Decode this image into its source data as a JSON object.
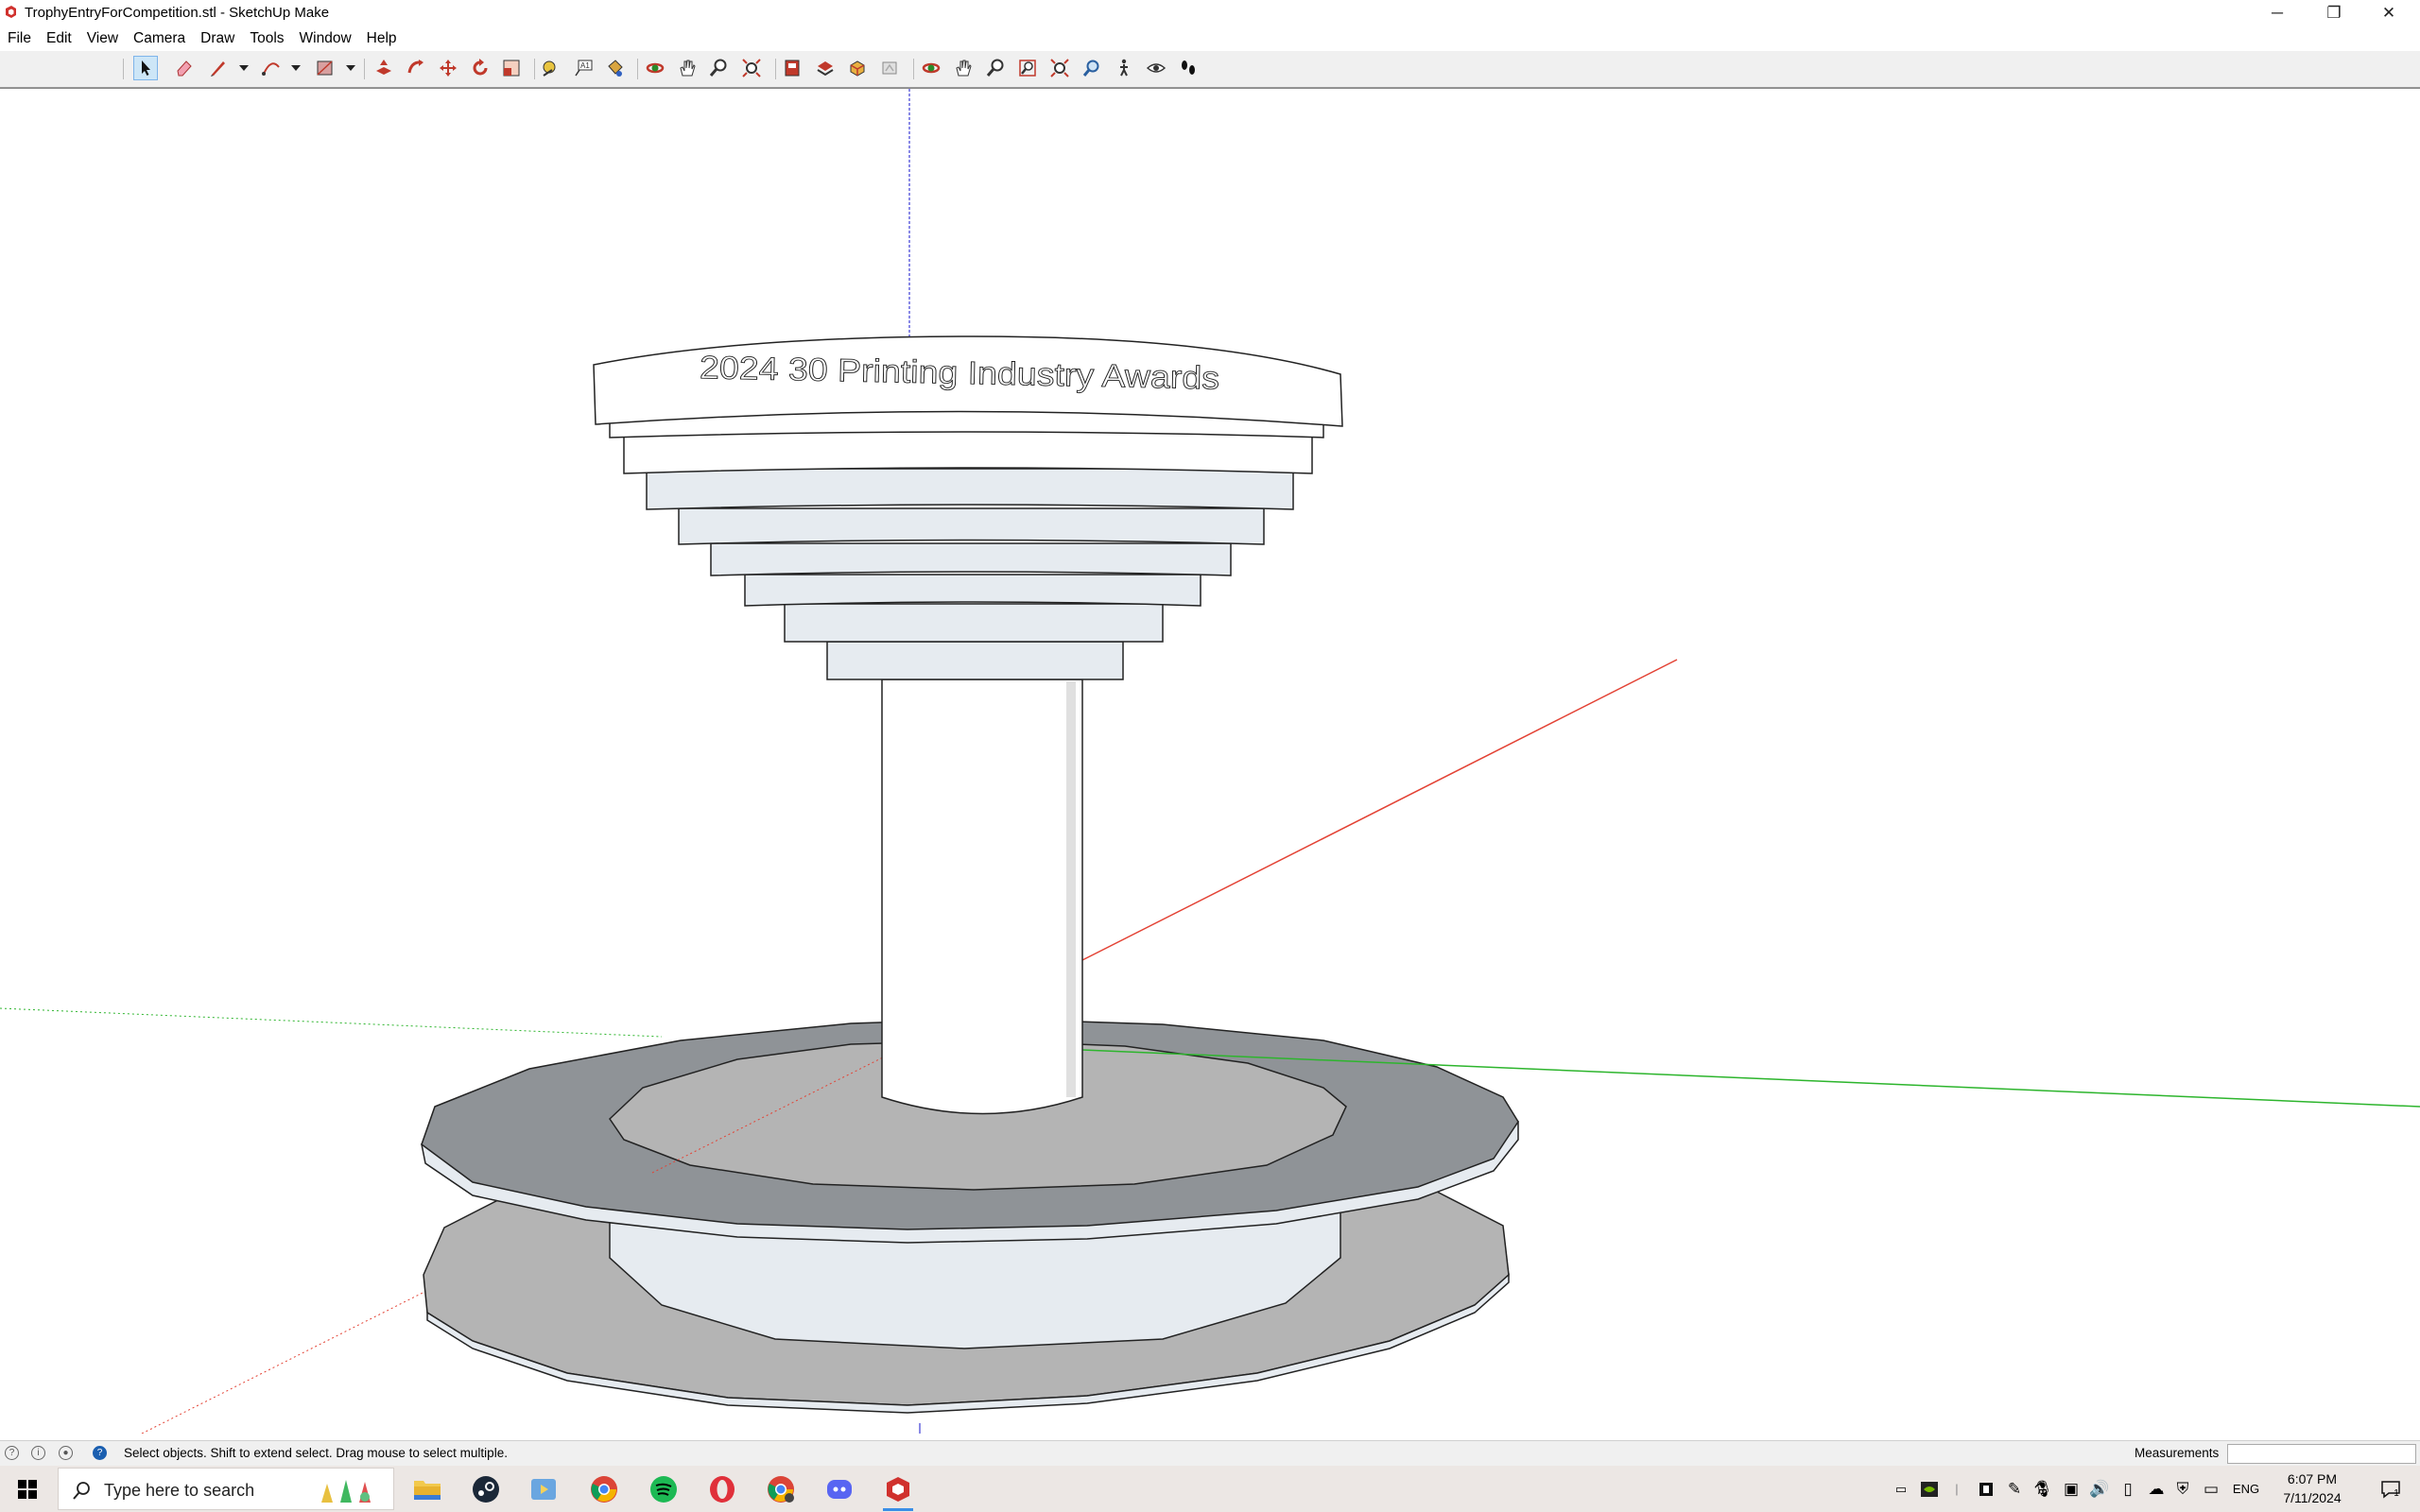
{
  "window": {
    "title": "TrophyEntryForCompetition.stl - SketchUp Make",
    "controls": {
      "minimize": "─",
      "restore": "❐",
      "close": "✕"
    }
  },
  "menu": [
    "File",
    "Edit",
    "View",
    "Camera",
    "Draw",
    "Tools",
    "Window",
    "Help"
  ],
  "toolbar": {
    "tools": [
      "select",
      "eraser",
      "line",
      "arc",
      "rectangle",
      "push-pull",
      "follow-me",
      "move",
      "rotate",
      "scale",
      "tape-measure",
      "text",
      "paint-bucket",
      "orbit",
      "pan",
      "zoom",
      "zoom-extents",
      "3d-warehouse",
      "extension-warehouse",
      "components",
      "styles",
      "section-plane",
      "position-camera",
      "zoom-window",
      "zoom-extents-2",
      "previous-view",
      "walk",
      "look-around",
      "footprints"
    ],
    "selected": "select"
  },
  "model": {
    "engraving": "2024 30 Printing Industry Awards",
    "axis_colors": {
      "red": "#e34234",
      "green": "#2db52d",
      "blue": "#3b3bd6"
    },
    "face_color": "#e6ebf0",
    "shadow_face_color": "#b4b4b4",
    "dark_face_color": "#8f9397"
  },
  "status": {
    "hint": "Select objects. Shift to extend select. Drag mouse to select multiple.",
    "measurements_label": "Measurements",
    "measurements_value": ""
  },
  "taskbar": {
    "search_placeholder": "Type here to search",
    "apps": [
      "file-explorer",
      "steam",
      "media-player",
      "chrome",
      "spotify",
      "opera",
      "chrome-profile",
      "discord",
      "sketchup"
    ],
    "active_app": "sketchup",
    "language": "ENG",
    "time": "6:07 PM",
    "date": "7/11/2024",
    "notification_count": "1"
  }
}
